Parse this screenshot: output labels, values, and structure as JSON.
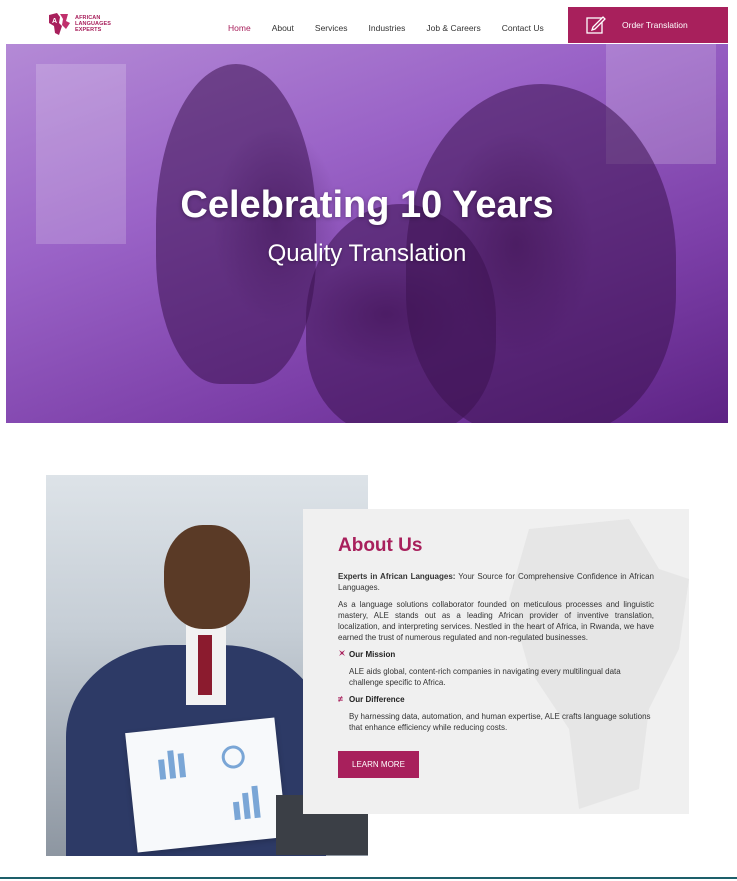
{
  "header": {
    "logo_text": [
      "AFRICAN",
      "LANGUAGES",
      "EXPERTS"
    ],
    "nav": [
      {
        "label": "Home",
        "active": true
      },
      {
        "label": "About",
        "active": false
      },
      {
        "label": "Services",
        "active": false
      },
      {
        "label": "Industries",
        "active": false
      },
      {
        "label": "Job & Careers",
        "active": false
      },
      {
        "label": "Contact Us",
        "active": false
      }
    ],
    "order_button": {
      "label": "Order Translation",
      "icon": "edit-icon"
    }
  },
  "hero": {
    "title": "Celebrating 10 Years",
    "subtitle": "Quality Translation"
  },
  "about": {
    "heading": "About Us",
    "intro_bold": "Experts in African Languages:",
    "intro_rest": " Your Source for Comprehensive Confidence in African Languages.",
    "paragraph": "As a language solutions collaborator founded on meticulous processes and linguistic mastery, ALE stands out as a leading African provider of inventive translation, localization, and interpreting services. Nestled in the heart of Africa, in Rwanda, we have earned the trust of numerous regulated and non-regulated businesses.",
    "mission_title": "Our Mission",
    "mission_icon": "mission-icon",
    "mission_text": "ALE aids global, content-rich companies in navigating every multilingual data challenge specific to Africa.",
    "difference_title": "Our Difference",
    "difference_icon": "not-equal-icon",
    "difference_text": "By harnessing data, automation, and human expertise, ALE crafts language solutions that enhance efficiency while reducing costs.",
    "button_label": "LEARN MORE"
  },
  "colors": {
    "brand": "#a8205c",
    "hero_overlay": "#8a4cc0",
    "card_bg": "#f0f0f0"
  }
}
